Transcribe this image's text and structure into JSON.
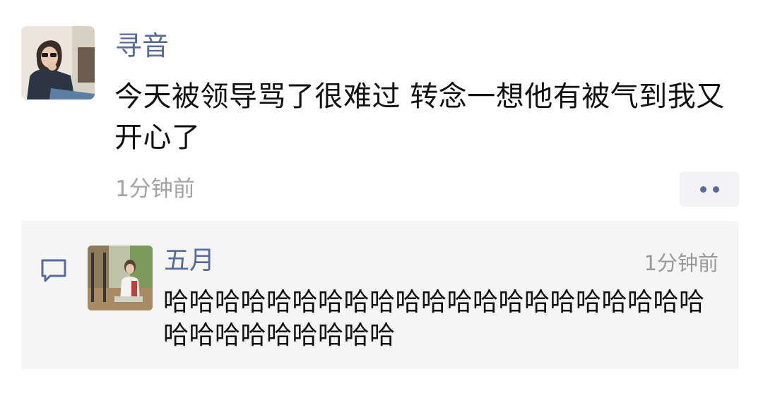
{
  "post": {
    "author": "寻音",
    "text": "今天被领导骂了很难过 转念一想他有被气到我又开心了",
    "time": "1分钟前",
    "more_icon": "more-dots-icon"
  },
  "comment": {
    "icon": "comment-bubble-icon",
    "author": "五月",
    "time": "1分钟前",
    "text": "哈哈哈哈哈哈哈哈哈哈哈哈哈哈哈哈哈哈哈哈哈哈哈哈哈哈哈哈哈哈"
  },
  "colors": {
    "name": "#576b95",
    "text": "#111111",
    "time": "#a3a3a3",
    "comment_bg": "#f5f5f6"
  }
}
